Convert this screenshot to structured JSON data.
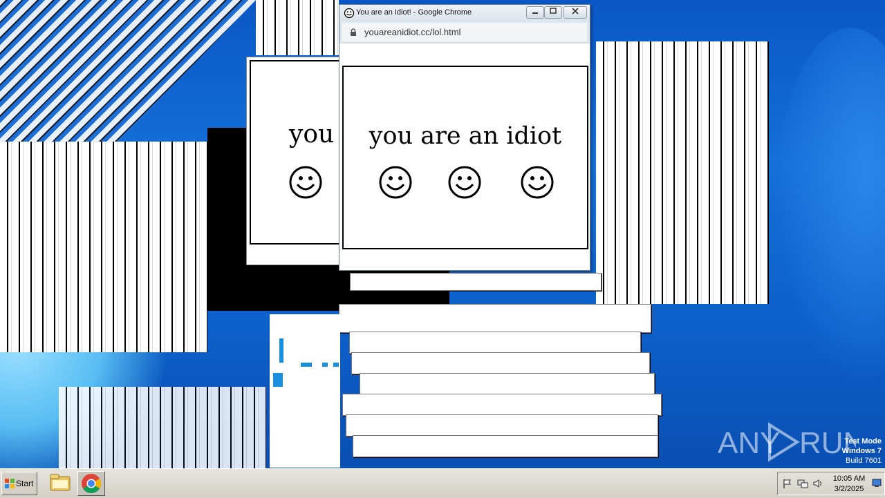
{
  "window": {
    "title": "You are an Idiot! - Google Chrome",
    "url": "youareanidiot.cc/lol.html"
  },
  "page": {
    "message": "you are an idiot",
    "smiley_icons": [
      "smiley-icon",
      "smiley-icon",
      "smiley-icon"
    ]
  },
  "background_window": {
    "message_fragment": "you a"
  },
  "watermark": {
    "logo_text": "ANY RUN",
    "os_lines": [
      "Test Mode",
      "Windows 7",
      "Build 7601"
    ]
  },
  "taskbar": {
    "start_label": "Start",
    "apps": [
      {
        "name": "windows-explorer",
        "icon": "folder-icon"
      },
      {
        "name": "google-chrome",
        "icon": "chrome-icon",
        "active": true
      }
    ],
    "tray": {
      "icons": [
        "flag-icon",
        "network-icon",
        "speaker-icon",
        "show-desktop-icon"
      ],
      "time": "10:05 AM",
      "date": "3/2/2025"
    }
  },
  "colors": {
    "desktop": "#1470d8",
    "taskbar": "#d4d0c8",
    "window_frame": "#dfe7ee"
  }
}
